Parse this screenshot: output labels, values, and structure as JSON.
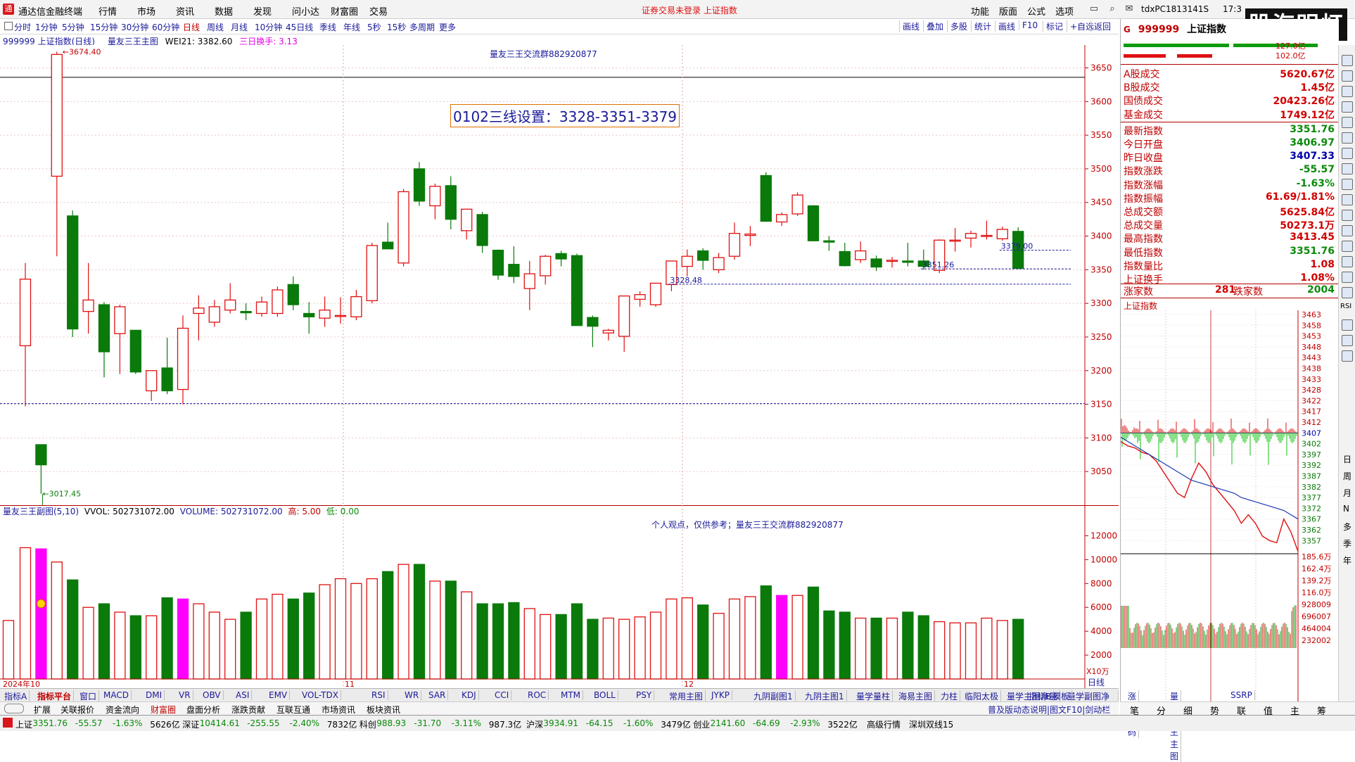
{
  "app": {
    "name": "通达信金融终端",
    "alert": "证券交易未登录  上证指数"
  },
  "menus": [
    "行情",
    "市场",
    "资讯",
    "数据",
    "发现",
    "问小达",
    "财富圈",
    "交易"
  ],
  "right_menus": [
    "功能",
    "版面",
    "公式",
    "选项"
  ],
  "terminal_id": "tdxPC1813141S",
  "clock": "17:3",
  "brand": "股海明灯",
  "periods": [
    "分时",
    "1分钟",
    "5分钟",
    "15分钟",
    "30分钟",
    "60分钟",
    "日线",
    "周线",
    "月线",
    "10分钟",
    "45日线",
    "季线",
    "年线",
    "5秒",
    "15秒",
    "多周期",
    "更多"
  ],
  "active_period": "日线",
  "toolbar_right": [
    "画线",
    "叠加",
    "多股",
    "统计",
    "画线",
    "F10",
    "标记",
    "+自选",
    "返回"
  ],
  "chart_header": {
    "name": "999999 上证指数(日线)",
    "sub": "量友三王主图",
    "wei": "WEI21: 3382.60",
    "turnover": "三日换手: 3.13"
  },
  "main_note": "量友三王交流群882920877",
  "setting_text": "0102三线设置：3328-3351-3379",
  "price_labels": {
    "high": "3674.40",
    "low": "3017.45",
    "l1": "3379.00",
    "l2": "3351.26",
    "l3": "3328.48"
  },
  "month_labels": {
    "m10": "2024年10",
    "m11": "11",
    "m12": "12"
  },
  "vol_header": {
    "name": "量友三王副图(5,10)",
    "vvol": "VVOL: 502731072.00",
    "volume": "VOLUME: 502731072.00",
    "high": "高: 5.00",
    "low": "低: 0.00"
  },
  "vol_note": "个人观点，仅供参考；量友三王交流群882920877",
  "vol_unit": "X10万",
  "axis_price": [
    "3650",
    "3600",
    "3550",
    "3500",
    "3450",
    "3400",
    "3350",
    "3300",
    "3250",
    "3200",
    "3150",
    "3100",
    "3050"
  ],
  "axis_vol": [
    "12000",
    "10000",
    "8000",
    "6000",
    "4000",
    "2000"
  ],
  "axis_period": "日线",
  "chart_data": {
    "type": "candlestick",
    "title": "999999 上证指数(日线)",
    "ylim": [
      3000,
      3680
    ],
    "candles": [
      {
        "o": 3237,
        "h": 3360,
        "l": 3147,
        "c": 3336
      },
      {
        "o": 3090,
        "h": 3090,
        "l": 3017,
        "c": 3060
      },
      {
        "o": 3489,
        "h": 3674,
        "l": 3370,
        "c": 3670
      },
      {
        "o": 3430,
        "h": 3438,
        "l": 3250,
        "c": 3262
      },
      {
        "o": 3288,
        "h": 3360,
        "l": 3255,
        "c": 3305
      },
      {
        "o": 3298,
        "h": 3302,
        "l": 3190,
        "c": 3228
      },
      {
        "o": 3255,
        "h": 3298,
        "l": 3195,
        "c": 3295
      },
      {
        "o": 3260,
        "h": 3260,
        "l": 3195,
        "c": 3198
      },
      {
        "o": 3170,
        "h": 3200,
        "l": 3155,
        "c": 3200
      },
      {
        "o": 3204,
        "h": 3249,
        "l": 3165,
        "c": 3170
      },
      {
        "o": 3172,
        "h": 3282,
        "l": 3150,
        "c": 3263
      },
      {
        "o": 3285,
        "h": 3312,
        "l": 3245,
        "c": 3293
      },
      {
        "o": 3272,
        "h": 3305,
        "l": 3265,
        "c": 3295
      },
      {
        "o": 3290,
        "h": 3330,
        "l": 3285,
        "c": 3305
      },
      {
        "o": 3288,
        "h": 3300,
        "l": 3275,
        "c": 3286
      },
      {
        "o": 3285,
        "h": 3310,
        "l": 3280,
        "c": 3302
      },
      {
        "o": 3285,
        "h": 3325,
        "l": 3280,
        "c": 3320
      },
      {
        "o": 3328,
        "h": 3340,
        "l": 3290,
        "c": 3298
      },
      {
        "o": 3285,
        "h": 3302,
        "l": 3255,
        "c": 3280
      },
      {
        "o": 3278,
        "h": 3310,
        "l": 3265,
        "c": 3290
      },
      {
        "o": 3281,
        "h": 3309,
        "l": 3270,
        "c": 3282
      },
      {
        "o": 3280,
        "h": 3320,
        "l": 3275,
        "c": 3310
      },
      {
        "o": 3304,
        "h": 3390,
        "l": 3300,
        "c": 3386
      },
      {
        "o": 3391,
        "h": 3420,
        "l": 3385,
        "c": 3381
      },
      {
        "o": 3360,
        "h": 3470,
        "l": 3355,
        "c": 3466
      },
      {
        "o": 3500,
        "h": 3510,
        "l": 3445,
        "c": 3452
      },
      {
        "o": 3445,
        "h": 3478,
        "l": 3425,
        "c": 3474
      },
      {
        "o": 3475,
        "h": 3489,
        "l": 3410,
        "c": 3425
      },
      {
        "o": 3408,
        "h": 3440,
        "l": 3395,
        "c": 3440
      },
      {
        "o": 3432,
        "h": 3436,
        "l": 3375,
        "c": 3386
      },
      {
        "o": 3379,
        "h": 3380,
        "l": 3335,
        "c": 3342
      },
      {
        "o": 3358,
        "h": 3385,
        "l": 3330,
        "c": 3340
      },
      {
        "o": 3322,
        "h": 3363,
        "l": 3290,
        "c": 3344
      },
      {
        "o": 3341,
        "h": 3372,
        "l": 3328,
        "c": 3370
      },
      {
        "o": 3374,
        "h": 3378,
        "l": 3355,
        "c": 3366
      },
      {
        "o": 3371,
        "h": 3374,
        "l": 3267,
        "c": 3267
      },
      {
        "o": 3279,
        "h": 3282,
        "l": 3235,
        "c": 3266
      },
      {
        "o": 3256,
        "h": 3262,
        "l": 3245,
        "c": 3260
      },
      {
        "o": 3251,
        "h": 3310,
        "l": 3228,
        "c": 3311
      },
      {
        "o": 3306,
        "h": 3318,
        "l": 3295,
        "c": 3313
      },
      {
        "o": 3298,
        "h": 3329,
        "l": 3295,
        "c": 3330
      },
      {
        "o": 3328,
        "h": 3363,
        "l": 3318,
        "c": 3363
      },
      {
        "o": 3355,
        "h": 3380,
        "l": 3340,
        "c": 3370
      },
      {
        "o": 3378,
        "h": 3382,
        "l": 3350,
        "c": 3364
      },
      {
        "o": 3350,
        "h": 3375,
        "l": 3345,
        "c": 3368
      },
      {
        "o": 3370,
        "h": 3420,
        "l": 3365,
        "c": 3404
      },
      {
        "o": 3401,
        "h": 3415,
        "l": 3385,
        "c": 3403
      },
      {
        "o": 3490,
        "h": 3495,
        "l": 3422,
        "c": 3422
      },
      {
        "o": 3421,
        "h": 3435,
        "l": 3415,
        "c": 3432
      },
      {
        "o": 3433,
        "h": 3465,
        "l": 3430,
        "c": 3461
      },
      {
        "o": 3445,
        "h": 3446,
        "l": 3393,
        "c": 3393
      },
      {
        "o": 3393,
        "h": 3400,
        "l": 3378,
        "c": 3391
      },
      {
        "o": 3377,
        "h": 3390,
        "l": 3355,
        "c": 3356
      },
      {
        "o": 3365,
        "h": 3392,
        "l": 3360,
        "c": 3378
      },
      {
        "o": 3366,
        "h": 3371,
        "l": 3348,
        "c": 3354
      },
      {
        "o": 3363,
        "h": 3369,
        "l": 3353,
        "c": 3364
      },
      {
        "o": 3363,
        "h": 3390,
        "l": 3355,
        "c": 3361
      },
      {
        "o": 3363,
        "h": 3380,
        "l": 3350,
        "c": 3355
      },
      {
        "o": 3349,
        "h": 3395,
        "l": 3345,
        "c": 3394
      },
      {
        "o": 3393,
        "h": 3412,
        "l": 3377,
        "c": 3394
      },
      {
        "o": 3397,
        "h": 3408,
        "l": 3383,
        "c": 3404
      },
      {
        "o": 3400,
        "h": 3423,
        "l": 3395,
        "c": 3401
      },
      {
        "o": 3396,
        "h": 3414,
        "l": 3393,
        "c": 3410
      },
      {
        "o": 3407,
        "h": 3413,
        "l": 3351,
        "c": 3352
      }
    ],
    "volumes": [
      4900,
      11000,
      10900,
      9800,
      8300,
      6000,
      6300,
      5600,
      5300,
      5300,
      6800,
      6700,
      6300,
      5600,
      5000,
      5600,
      6700,
      7100,
      6700,
      7200,
      7900,
      8400,
      8000,
      8400,
      9000,
      9600,
      9600,
      8200,
      8200,
      7300,
      6300,
      6300,
      6400,
      5900,
      5400,
      5400,
      6300,
      5000,
      5100,
      5000,
      5200,
      5600,
      6700,
      6800,
      6200,
      5500,
      6700,
      6900,
      7800,
      7000,
      7000,
      7700,
      5700,
      5600,
      5100,
      5100,
      5100,
      5600,
      5300,
      4800,
      4700,
      4700,
      5100,
      4900,
      5000
    ]
  },
  "quote": {
    "code": "999999",
    "name": "上证指数",
    "top_vals": [
      "127.0亿",
      "102.0亿"
    ],
    "rows": [
      {
        "k": "A股成交",
        "v": "5620.67亿",
        "cls": "up"
      },
      {
        "k": "B股成交",
        "v": "1.45亿",
        "cls": "up"
      },
      {
        "k": "国债成交",
        "v": "20423.26亿",
        "cls": "up"
      },
      {
        "k": "基金成交",
        "v": "1749.12亿",
        "cls": "up"
      },
      {
        "k": "最新指数",
        "v": "3351.76",
        "cls": "dn"
      },
      {
        "k": "今日开盘",
        "v": "3406.97",
        "cls": "dn"
      },
      {
        "k": "昨日收盘",
        "v": "3407.33",
        "cls": "blk"
      },
      {
        "k": "指数涨跌",
        "v": "-55.57",
        "cls": "dn"
      },
      {
        "k": "指数涨幅",
        "v": "-1.63%",
        "cls": "dn"
      },
      {
        "k": "指数振幅",
        "v": "61.69/1.81%",
        "cls": "up"
      },
      {
        "k": "总成交额",
        "v": "5625.84亿",
        "cls": "up"
      },
      {
        "k": "总成交量",
        "v": "50273.1万",
        "cls": "up"
      },
      {
        "k": "最高指数",
        "v": "3413.45",
        "cls": "up"
      },
      {
        "k": "最低指数",
        "v": "3351.76",
        "cls": "dn"
      },
      {
        "k": "指数量比",
        "v": "1.08",
        "cls": "up"
      },
      {
        "k": "上证换手",
        "v": "1.08%",
        "cls": "up"
      }
    ],
    "up_label": "涨家数",
    "up_count": "281",
    "down_label": "跌家数",
    "down_count": "2004",
    "mini_title": "上证指数",
    "mini_price_ticks": [
      "3463",
      "3458",
      "3453",
      "3448",
      "3443",
      "3438",
      "3433",
      "3428",
      "3422",
      "3417",
      "3412",
      "3407",
      "3402",
      "3397",
      "3392",
      "3387",
      "3382",
      "3377",
      "3372",
      "3367",
      "3362",
      "3357"
    ],
    "mini_vol_ticks": [
      "185.6万",
      "162.4万",
      "139.2万",
      "116.0万",
      "928009",
      "696007",
      "464004",
      "232002"
    ]
  },
  "right_strip": [
    "日",
    "周",
    "月",
    "N",
    "多",
    "季",
    "年"
  ],
  "right_strip_extra": "RSI",
  "indicators": [
    "指标A",
    "指标平台",
    "窗口",
    "MACD",
    "DMI",
    "VR",
    "OBV",
    "ASI",
    "EMV",
    "VOL-TDX",
    "RSI",
    "WR",
    "SAR",
    "KDJ",
    "CCI",
    "ROC",
    "MTM",
    "BOLL",
    "PSY",
    "常用主图",
    "JYKP",
    "九阴副图1",
    "九阴主图1",
    "量学量柱",
    "海易主图",
    "力柱",
    "临阳太极",
    "量学主图净量",
    "量学副图净量",
    "涨停密码",
    "量友三王主图",
    "SSRP"
  ],
  "indicators_right": [
    "指标B",
    "模板"
  ],
  "ext_items": [
    "扩展",
    "关联报价",
    "资金流向",
    "财富圈",
    "盘面分析",
    "涨跌贡献",
    "互联互通",
    "市场资讯",
    "板块资讯"
  ],
  "ext_right": "普及版动态说明|图文F10|剑动栏",
  "rtabs": [
    "笔",
    "分",
    "细",
    "势",
    "联",
    "值",
    "主",
    "筹"
  ],
  "status": [
    {
      "t": "上证",
      "c": "k"
    },
    {
      "t": "3351.76",
      "c": "dn"
    },
    {
      "t": "-55.57",
      "c": "dn"
    },
    {
      "t": "-1.63%",
      "c": "dn"
    },
    {
      "t": "5626亿",
      "c": "k"
    },
    {
      "t": "深证",
      "c": "k"
    },
    {
      "t": "10414.61",
      "c": "dn"
    },
    {
      "t": "-255.55",
      "c": "dn"
    },
    {
      "t": "-2.40%",
      "c": "dn"
    },
    {
      "t": "7832亿",
      "c": "k"
    },
    {
      "t": "科创",
      "c": "k"
    },
    {
      "t": "988.93",
      "c": "dn"
    },
    {
      "t": "-31.70",
      "c": "dn"
    },
    {
      "t": "-3.11%",
      "c": "dn"
    },
    {
      "t": "987.3亿",
      "c": "k"
    },
    {
      "t": "沪深",
      "c": "k"
    },
    {
      "t": "3934.91",
      "c": "dn"
    },
    {
      "t": "-64.15",
      "c": "dn"
    },
    {
      "t": "-1.60%",
      "c": "dn"
    },
    {
      "t": "3479亿",
      "c": "k"
    },
    {
      "t": "创业",
      "c": "k"
    },
    {
      "t": "2141.60",
      "c": "dn"
    },
    {
      "t": "-64.69",
      "c": "dn"
    },
    {
      "t": "-2.93%",
      "c": "dn"
    },
    {
      "t": "3522亿",
      "c": "k"
    }
  ],
  "status_right": [
    "高级行情",
    "深圳双线15"
  ],
  "colors": {
    "up": "#e01010",
    "down": "#0a7a0a",
    "magenta": "#ff00ff",
    "axis": "#c00000",
    "note": "#1a1a9a"
  }
}
